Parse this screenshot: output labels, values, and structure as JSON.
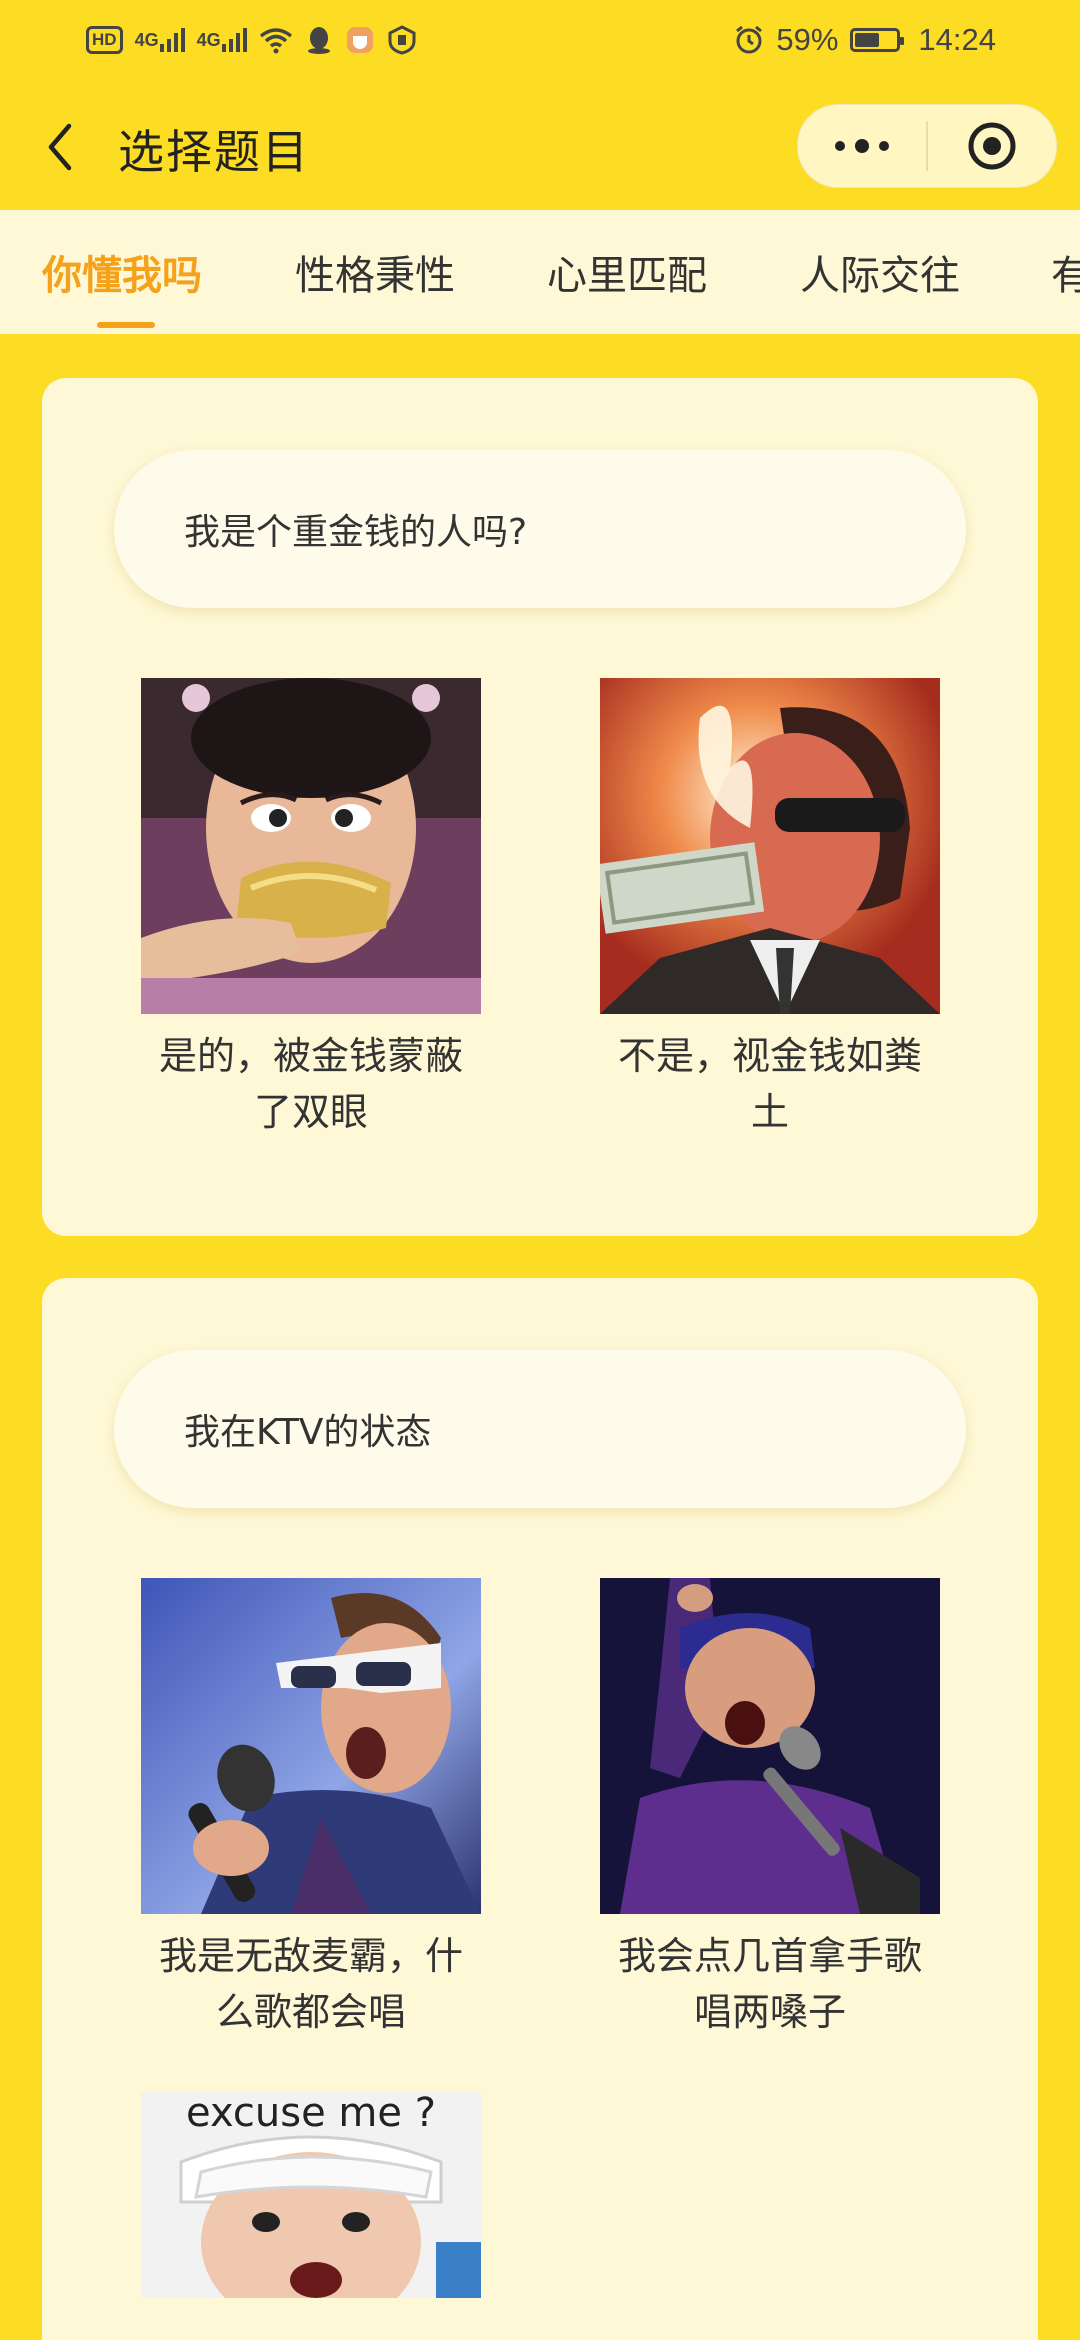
{
  "status_bar": {
    "left_icons": [
      "hd-icon",
      "signal-4g-icon",
      "signal-4g-icon",
      "wifi-icon",
      "qq-icon",
      "cup-icon",
      "shield-icon"
    ],
    "sig_label": "4G",
    "hd_label": "HD",
    "battery_percent": "59%",
    "battery_level": 0.59,
    "time": "14:24"
  },
  "nav": {
    "title": "选择题目"
  },
  "tabs": [
    "你懂我吗",
    "性格秉性",
    "心里匹配",
    "人际交往",
    "有"
  ],
  "active_tab": 0,
  "questions": [
    {
      "text": "我是个重金钱的人吗?",
      "options": [
        {
          "caption": "是的，被金钱蒙蔽了双眼",
          "image": "woman-biting-gold-ingot"
        },
        {
          "caption": "不是，视金钱如粪土",
          "image": "man-burning-banknote"
        }
      ]
    },
    {
      "text": "我在KTV的状态",
      "options": [
        {
          "caption": "我是无敌麦霸，什么歌都会唱",
          "image": "man-singing-microphone"
        },
        {
          "caption": "我会点几首拿手歌唱两嗓子",
          "image": "man-singing-on-stage"
        },
        {
          "caption": "",
          "image": "excuse-me-meme",
          "image_text": "excuse me ?"
        }
      ]
    }
  ],
  "colors": {
    "background": "#FDDD24",
    "card": "#FEF8D6",
    "accent": "#F5A11A"
  }
}
